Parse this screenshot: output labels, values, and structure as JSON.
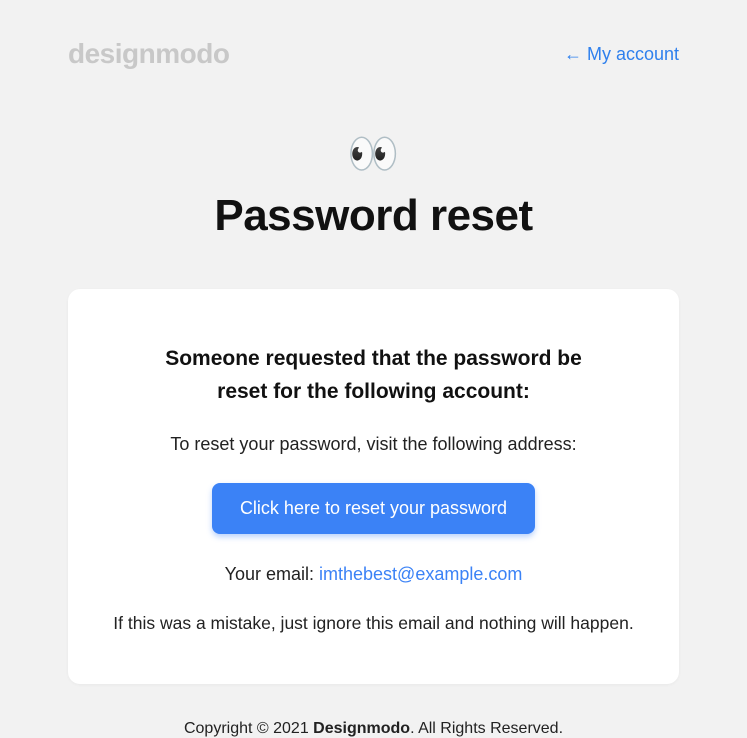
{
  "header": {
    "logo": "designmodo",
    "my_account_label": "← My account"
  },
  "hero": {
    "emoji": "👀",
    "title": "Password reset"
  },
  "card": {
    "heading_line1": "Someone requested that the password be",
    "heading_line2": "reset for the following account:",
    "instructions": "To reset your password, visit the following address:",
    "button_label": "Click here to reset your password",
    "email_prefix": "Your email: ",
    "email": "imthebest@example.com",
    "mistake_text": "If this was a mistake, just ignore this email and nothing will happen."
  },
  "footer": {
    "prefix": "Copyright © 2021 ",
    "brand": "Designmodo",
    "suffix": ". All Rights Reserved."
  },
  "colors": {
    "accent": "#3b82f6",
    "logo_gray": "#c8c8c8",
    "bg": "#f2f2f2"
  }
}
